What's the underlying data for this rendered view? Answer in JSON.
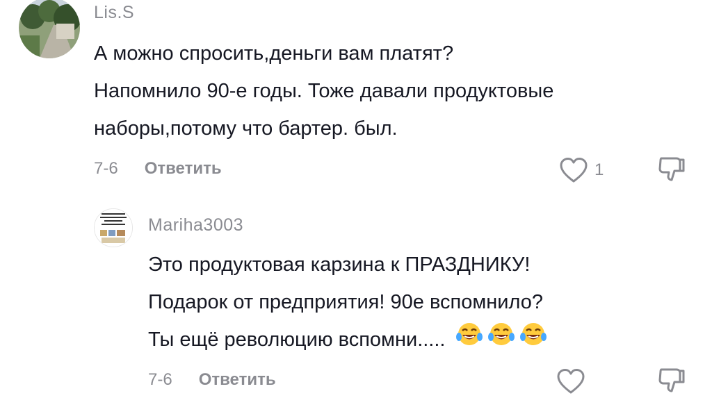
{
  "comments": [
    {
      "username": "Lis.S",
      "lines": [
        "А можно спросить,деньги вам платят?",
        "Напомнило 90-е годы. Тоже давали продуктовые",
        "наборы,потому что бартер. был."
      ],
      "date": "7-6",
      "reply_label": "Ответить",
      "likes": "1"
    },
    {
      "username": "Mariha3003",
      "lines": [
        "Это продуктовая карзина к ПРАЗДНИКУ!",
        "Подарок от предприятия! 90е вспомнило?",
        "Ты ещё революцию вспомни....."
      ],
      "emoji": [
        "laughing-tears-emoji",
        "laughing-tears-emoji",
        "laughing-tears-emoji"
      ],
      "date": "7-6",
      "reply_label": "Ответить"
    }
  ],
  "icons": {
    "like": "heart-outline-icon",
    "dislike": "thumbs-down-outline-icon"
  },
  "colors": {
    "text": "#161823",
    "secondary": "#8a8b91"
  }
}
